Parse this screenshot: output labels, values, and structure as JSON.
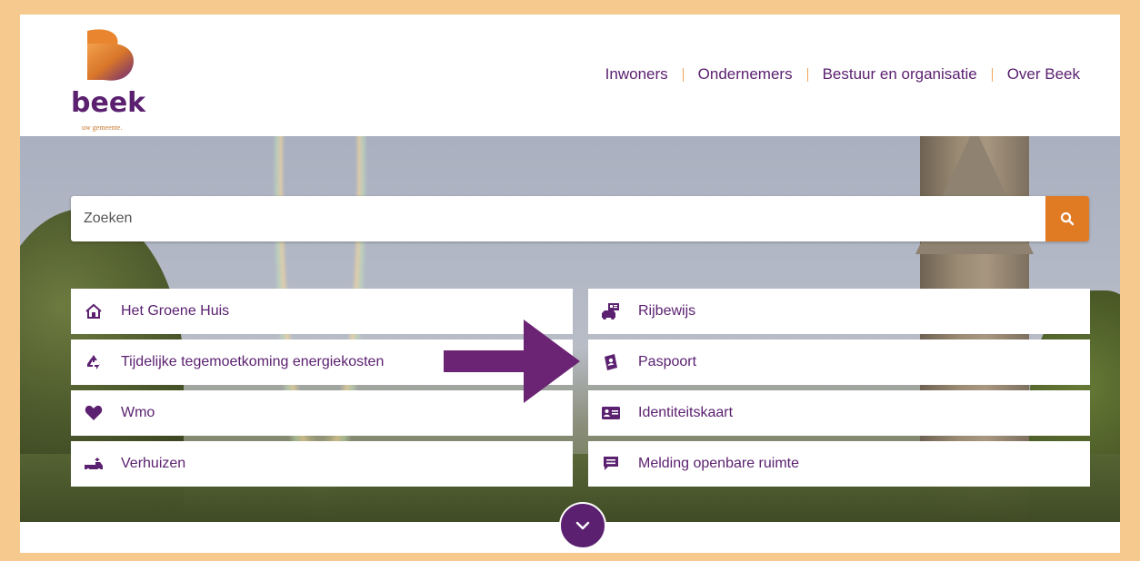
{
  "header": {
    "logo_text": "beek",
    "logo_tagline": "uw gemeente.",
    "nav": [
      {
        "label": "Inwoners"
      },
      {
        "label": "Ondernemers"
      },
      {
        "label": "Bestuur en organisatie"
      },
      {
        "label": "Over Beek"
      }
    ]
  },
  "search": {
    "placeholder": "Zoeken",
    "button_icon": "search-icon"
  },
  "tiles_left": [
    {
      "label": "Het Groene Huis",
      "icon": "house-icon"
    },
    {
      "label": "Tijdelijke tegemoetkoming energiekosten",
      "icon": "recycle-icon"
    },
    {
      "label": "Wmo",
      "icon": "heart-icon"
    },
    {
      "label": "Verhuizen",
      "icon": "moving-truck-icon"
    }
  ],
  "tiles_right": [
    {
      "label": "Rijbewijs",
      "icon": "car-license-icon"
    },
    {
      "label": "Paspoort",
      "icon": "passport-icon"
    },
    {
      "label": "Identiteitskaart",
      "icon": "id-card-icon"
    },
    {
      "label": "Melding openbare ruimte",
      "icon": "message-icon"
    }
  ],
  "annotation": {
    "icon": "arrow-right-icon",
    "color": "#6b2474"
  },
  "colors": {
    "brand_purple": "#5b2170",
    "accent_orange": "#e07b24",
    "frame": "#f6c98e"
  },
  "scroll_button": {
    "icon": "chevron-down-icon"
  }
}
